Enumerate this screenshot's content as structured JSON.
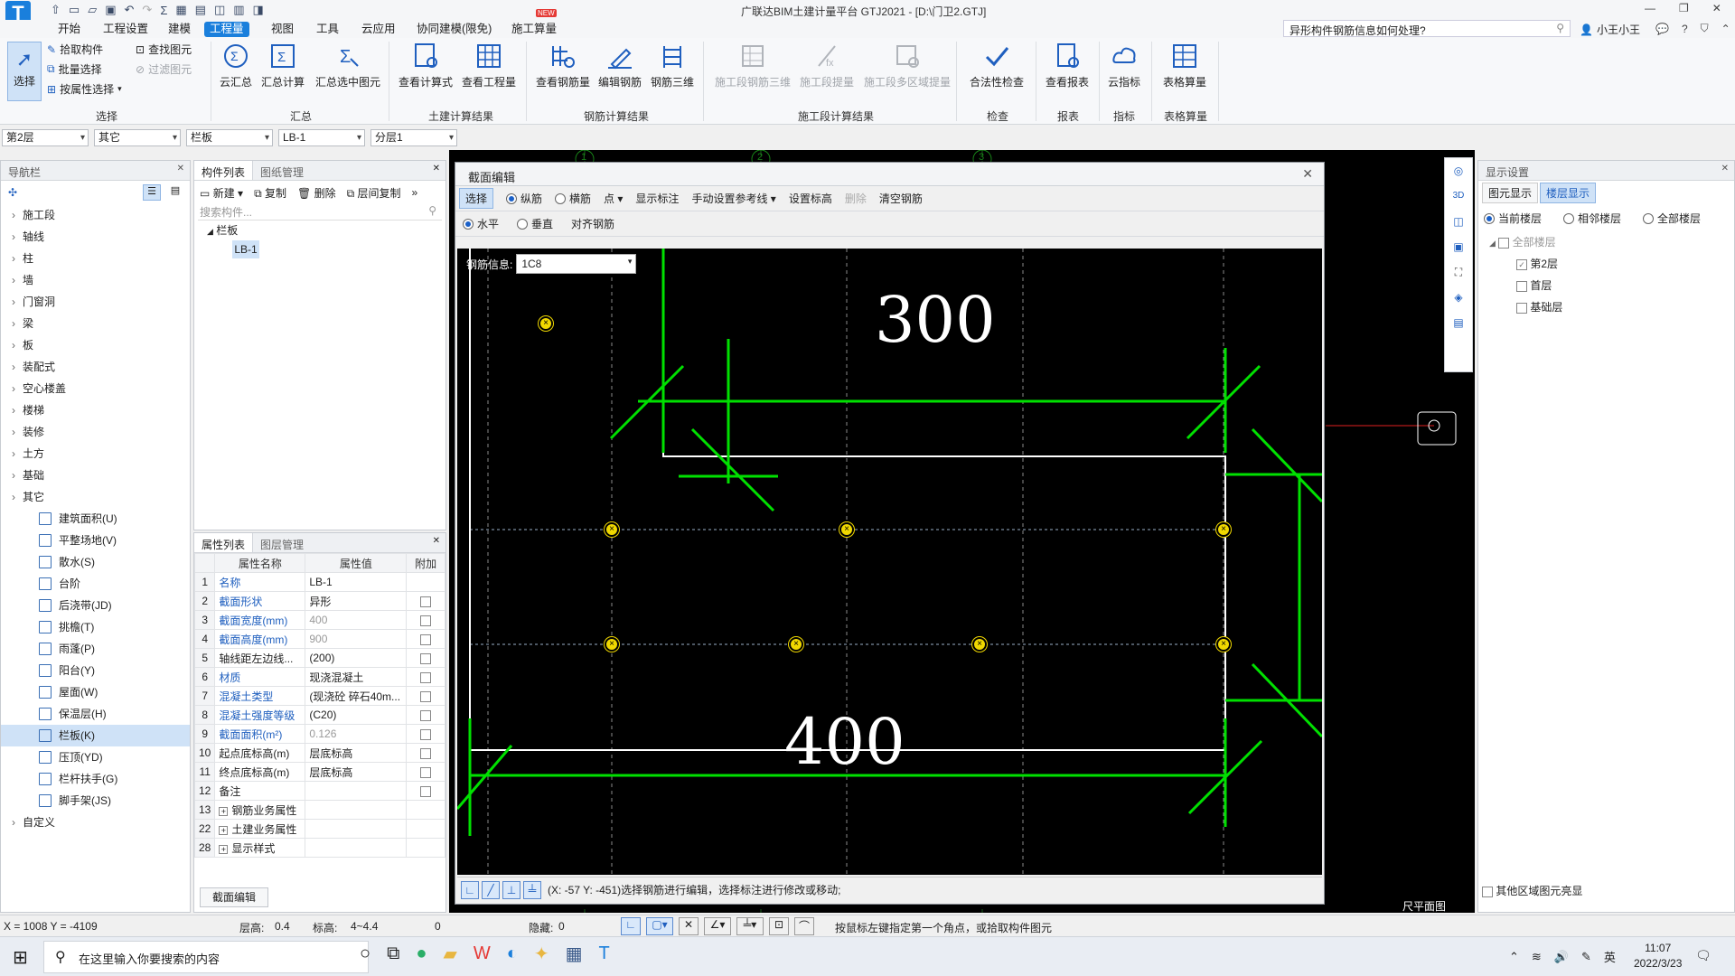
{
  "app": {
    "title": "广联达BIM土建计量平台 GTJ2021 - [D:\\门卫2.GTJ]",
    "help_search_placeholder": "异形构件钢筋信息如何处理?",
    "user": "小王小王"
  },
  "menu": [
    {
      "label": "开始"
    },
    {
      "label": "工程设置"
    },
    {
      "label": "建模"
    },
    {
      "label": "工程量"
    },
    {
      "label": "视图"
    },
    {
      "label": "工具"
    },
    {
      "label": "云应用"
    },
    {
      "label": "协同建模(限免)"
    },
    {
      "label": "施工算量",
      "badge": "NEW"
    }
  ],
  "ribbon": {
    "select": {
      "label": "选择",
      "pick": "拾取构件",
      "batch": "批量选择",
      "by_attr": "按属性选择",
      "find": "查找图元",
      "filter": "过滤图元",
      "group": "选择"
    },
    "summary": {
      "cloud": "云汇总",
      "calc": "汇总计算",
      "selected": "汇总选中图元",
      "group": "汇总"
    },
    "civil": {
      "formula": "查看计算式",
      "quantity": "查看工程量",
      "group": "土建计算结果"
    },
    "rebar": {
      "view": "查看钢筋量",
      "edit": "编辑钢筋",
      "threed": "钢筋三维",
      "group": "钢筋计算结果"
    },
    "stage": {
      "rebar3d": "施工段钢筋三维",
      "extract": "施工段提量",
      "multi": "施工段多区域提量",
      "group": "施工段计算结果"
    },
    "check": {
      "legal": "合法性检查",
      "group": "检查"
    },
    "report": {
      "view": "查看报表",
      "group": "报表"
    },
    "index": {
      "cloud": "云指标",
      "group": "指标"
    },
    "table": {
      "calc": "表格算量",
      "group": "表格算量"
    }
  },
  "combos": {
    "floor": "第2层",
    "type": "其它",
    "component": "栏板",
    "name": "LB-1",
    "layer": "分层1"
  },
  "nav": {
    "title": "导航栏",
    "items": [
      "施工段",
      "轴线",
      "柱",
      "墙",
      "门窗洞",
      "梁",
      "板",
      "装配式",
      "空心楼盖",
      "楼梯",
      "装修",
      "土方",
      "基础",
      "其它"
    ],
    "sub_items": [
      "建筑面积(U)",
      "平整场地(V)",
      "散水(S)",
      "台阶",
      "后浇带(JD)",
      "挑檐(T)",
      "雨蓬(P)",
      "阳台(Y)",
      "屋面(W)",
      "保温层(H)",
      "栏板(K)",
      "压顶(YD)",
      "栏杆扶手(G)",
      "脚手架(JS)"
    ],
    "last": "自定义"
  },
  "component_list": {
    "tabs": [
      "构件列表",
      "图纸管理"
    ],
    "new": "新建",
    "copy": "复制",
    "delete": "删除",
    "layer_copy": "层间复制",
    "search_placeholder": "搜索构件...",
    "group": "栏板",
    "item": "LB-1"
  },
  "properties": {
    "tabs": [
      "属性列表",
      "图层管理"
    ],
    "headers": [
      "属性名称",
      "属性值",
      "附加"
    ],
    "rows": [
      {
        "no": "1",
        "name": "名称",
        "value": "LB-1",
        "blue": true,
        "cb": false
      },
      {
        "no": "2",
        "name": "截面形状",
        "value": "异形",
        "blue": true,
        "cb": true
      },
      {
        "no": "3",
        "name": "截面宽度(mm)",
        "value": "400",
        "blue": true,
        "gray": true,
        "cb": true
      },
      {
        "no": "4",
        "name": "截面高度(mm)",
        "value": "900",
        "blue": true,
        "gray": true,
        "cb": true
      },
      {
        "no": "5",
        "name": "轴线距左边线...",
        "value": "(200)",
        "cb": true
      },
      {
        "no": "6",
        "name": "材质",
        "value": "现浇混凝土",
        "blue": true,
        "cb": true
      },
      {
        "no": "7",
        "name": "混凝土类型",
        "value": "(现浇砼 碎石40m...",
        "blue": true,
        "cb": true
      },
      {
        "no": "8",
        "name": "混凝土强度等级",
        "value": "(C20)",
        "blue": true,
        "cb": true
      },
      {
        "no": "9",
        "name": "截面面积(m²)",
        "value": "0.126",
        "blue": true,
        "gray": true,
        "cb": true
      },
      {
        "no": "10",
        "name": "起点底标高(m)",
        "value": "层底标高",
        "cb": true
      },
      {
        "no": "11",
        "name": "终点底标高(m)",
        "value": "层底标高",
        "cb": true
      },
      {
        "no": "12",
        "name": "备注",
        "value": "",
        "cb": true
      },
      {
        "no": "13",
        "name": "钢筋业务属性",
        "value": "",
        "expand": true
      },
      {
        "no": "22",
        "name": "土建业务属性",
        "value": "",
        "expand": true
      },
      {
        "no": "28",
        "name": "显示样式",
        "value": "",
        "expand": true
      }
    ],
    "edit_button": "截面编辑"
  },
  "dialog": {
    "title": "截面编辑",
    "select": "选择",
    "long_rebar": "纵筋",
    "stirrup": "横筋",
    "point": "点",
    "show_dim": "显示标注",
    "manual_ref": "手动设置参考线",
    "set_elev": "设置标高",
    "delete": "删除",
    "clear": "清空钢筋",
    "horizontal": "水平",
    "vertical": "垂直",
    "align": "对齐钢筋",
    "rebar_info_label": "钢筋信息:",
    "rebar_info_value": "1C8",
    "dim_top": "300",
    "dim_bottom": "400",
    "status": "(X: -57 Y: -451)选择钢筋进行编辑，选择标注进行修改或移动;"
  },
  "axis_labels": [
    "1",
    "2",
    "3"
  ],
  "canvas_label": "尺平面图",
  "display_settings": {
    "title": "显示设置",
    "tabs": [
      "图元显示",
      "楼层显示"
    ],
    "radios": [
      "当前楼层",
      "相邻楼层",
      "全部楼层"
    ],
    "tree_root": "全部楼层",
    "floors": [
      {
        "name": "第2层",
        "checked": true
      },
      {
        "name": "首层",
        "checked": false
      },
      {
        "name": "基础层",
        "checked": false
      }
    ],
    "other_bright": "其他区域图元亮显"
  },
  "status": {
    "coords": "X = 1008 Y = -4109",
    "floor_height_label": "层高:",
    "floor_height": "0.4",
    "elevation_label": "标高:",
    "elevation": "4~4.4",
    "zero": "0",
    "hidden_label": "隐藏:",
    "hidden": "0",
    "hint": "按鼠标左键指定第一个角点，或拾取构件图元"
  },
  "taskbar": {
    "search_placeholder": "在这里输入你要搜索的内容",
    "time": "11:07",
    "date": "2022/3/23",
    "lang": "英"
  },
  "colors": {
    "accent": "#1a7fdc",
    "rebar_green": "#00e000",
    "rebar_point": "#f0d800"
  }
}
